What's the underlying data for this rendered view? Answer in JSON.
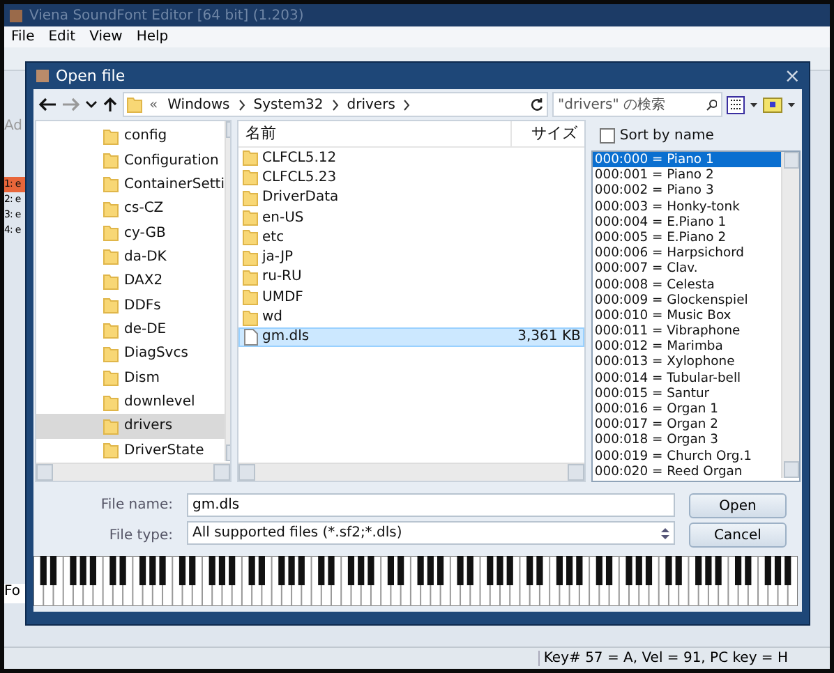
{
  "app": {
    "title": "Viena SoundFont Editor [64 bit] (1.203)",
    "menu": [
      "File",
      "Edit",
      "View",
      "Help"
    ],
    "side_label": "Ad",
    "side_items": [
      {
        "label": "1: e",
        "selected": true
      },
      {
        "label": "2: e",
        "selected": false
      },
      {
        "label": "3: e",
        "selected": false
      },
      {
        "label": "4: e",
        "selected": false
      }
    ],
    "lower_label": "Fo",
    "status": "Key# 57 = A, Vel = 91, PC key = H"
  },
  "dialog": {
    "title": "Open file",
    "close": "×",
    "breadcrumb": {
      "overflow": "«",
      "parts": [
        "Windows",
        "System32",
        "drivers"
      ]
    },
    "search": {
      "placeholder": "\"drivers\" の検索"
    },
    "tree": [
      {
        "label": "config",
        "selected": false
      },
      {
        "label": "Configuration",
        "selected": false
      },
      {
        "label": "ContainerSetti",
        "selected": false
      },
      {
        "label": "cs-CZ",
        "selected": false
      },
      {
        "label": "cy-GB",
        "selected": false
      },
      {
        "label": "da-DK",
        "selected": false
      },
      {
        "label": "DAX2",
        "selected": false
      },
      {
        "label": "DDFs",
        "selected": false
      },
      {
        "label": "de-DE",
        "selected": false
      },
      {
        "label": "DiagSvcs",
        "selected": false
      },
      {
        "label": "Dism",
        "selected": false
      },
      {
        "label": "downlevel",
        "selected": false
      },
      {
        "label": "drivers",
        "selected": true
      },
      {
        "label": "DriverState",
        "selected": false
      }
    ],
    "columns": [
      "名前",
      "サイズ"
    ],
    "files": [
      {
        "name": "CLFCL5.12",
        "kind": "folder",
        "selected": false
      },
      {
        "name": "CLFCL5.23",
        "kind": "folder",
        "selected": false
      },
      {
        "name": "DriverData",
        "kind": "folder",
        "selected": false
      },
      {
        "name": "en-US",
        "kind": "folder",
        "selected": false
      },
      {
        "name": "etc",
        "kind": "folder",
        "selected": false
      },
      {
        "name": "ja-JP",
        "kind": "folder",
        "selected": false
      },
      {
        "name": "ru-RU",
        "kind": "folder",
        "selected": false
      },
      {
        "name": "UMDF",
        "kind": "folder",
        "selected": false
      },
      {
        "name": "wd",
        "kind": "folder",
        "selected": false
      },
      {
        "name": "gm.dls",
        "kind": "file",
        "size": "3,361 KB",
        "selected": true
      }
    ],
    "sort_by_name": {
      "label": "Sort by name",
      "checked": false
    },
    "patches": [
      {
        "label": "000:000 = Piano 1",
        "selected": true
      },
      {
        "label": "000:001 = Piano 2",
        "selected": false
      },
      {
        "label": "000:002 = Piano 3",
        "selected": false
      },
      {
        "label": "000:003 = Honky-tonk",
        "selected": false
      },
      {
        "label": "000:004 = E.Piano 1",
        "selected": false
      },
      {
        "label": "000:005 = E.Piano 2",
        "selected": false
      },
      {
        "label": "000:006 = Harpsichord",
        "selected": false
      },
      {
        "label": "000:007 = Clav.",
        "selected": false
      },
      {
        "label": "000:008 = Celesta",
        "selected": false
      },
      {
        "label": "000:009 = Glockenspiel",
        "selected": false
      },
      {
        "label": "000:010 = Music Box",
        "selected": false
      },
      {
        "label": "000:011 = Vibraphone",
        "selected": false
      },
      {
        "label": "000:012 = Marimba",
        "selected": false
      },
      {
        "label": "000:013 = Xylophone",
        "selected": false
      },
      {
        "label": "000:014 = Tubular-bell",
        "selected": false
      },
      {
        "label": "000:015 = Santur",
        "selected": false
      },
      {
        "label": "000:016 = Organ 1",
        "selected": false
      },
      {
        "label": "000:017 = Organ 2",
        "selected": false
      },
      {
        "label": "000:018 = Organ 3",
        "selected": false
      },
      {
        "label": "000:019 = Church Org.1",
        "selected": false
      },
      {
        "label": "000:020 = Reed Organ",
        "selected": false
      }
    ],
    "file_name": {
      "label": "File name:",
      "value": "gm.dls"
    },
    "file_type": {
      "label": "File type:",
      "value": "All supported files (*.sf2;*.dls)"
    },
    "buttons": [
      "Open",
      "Cancel"
    ]
  }
}
